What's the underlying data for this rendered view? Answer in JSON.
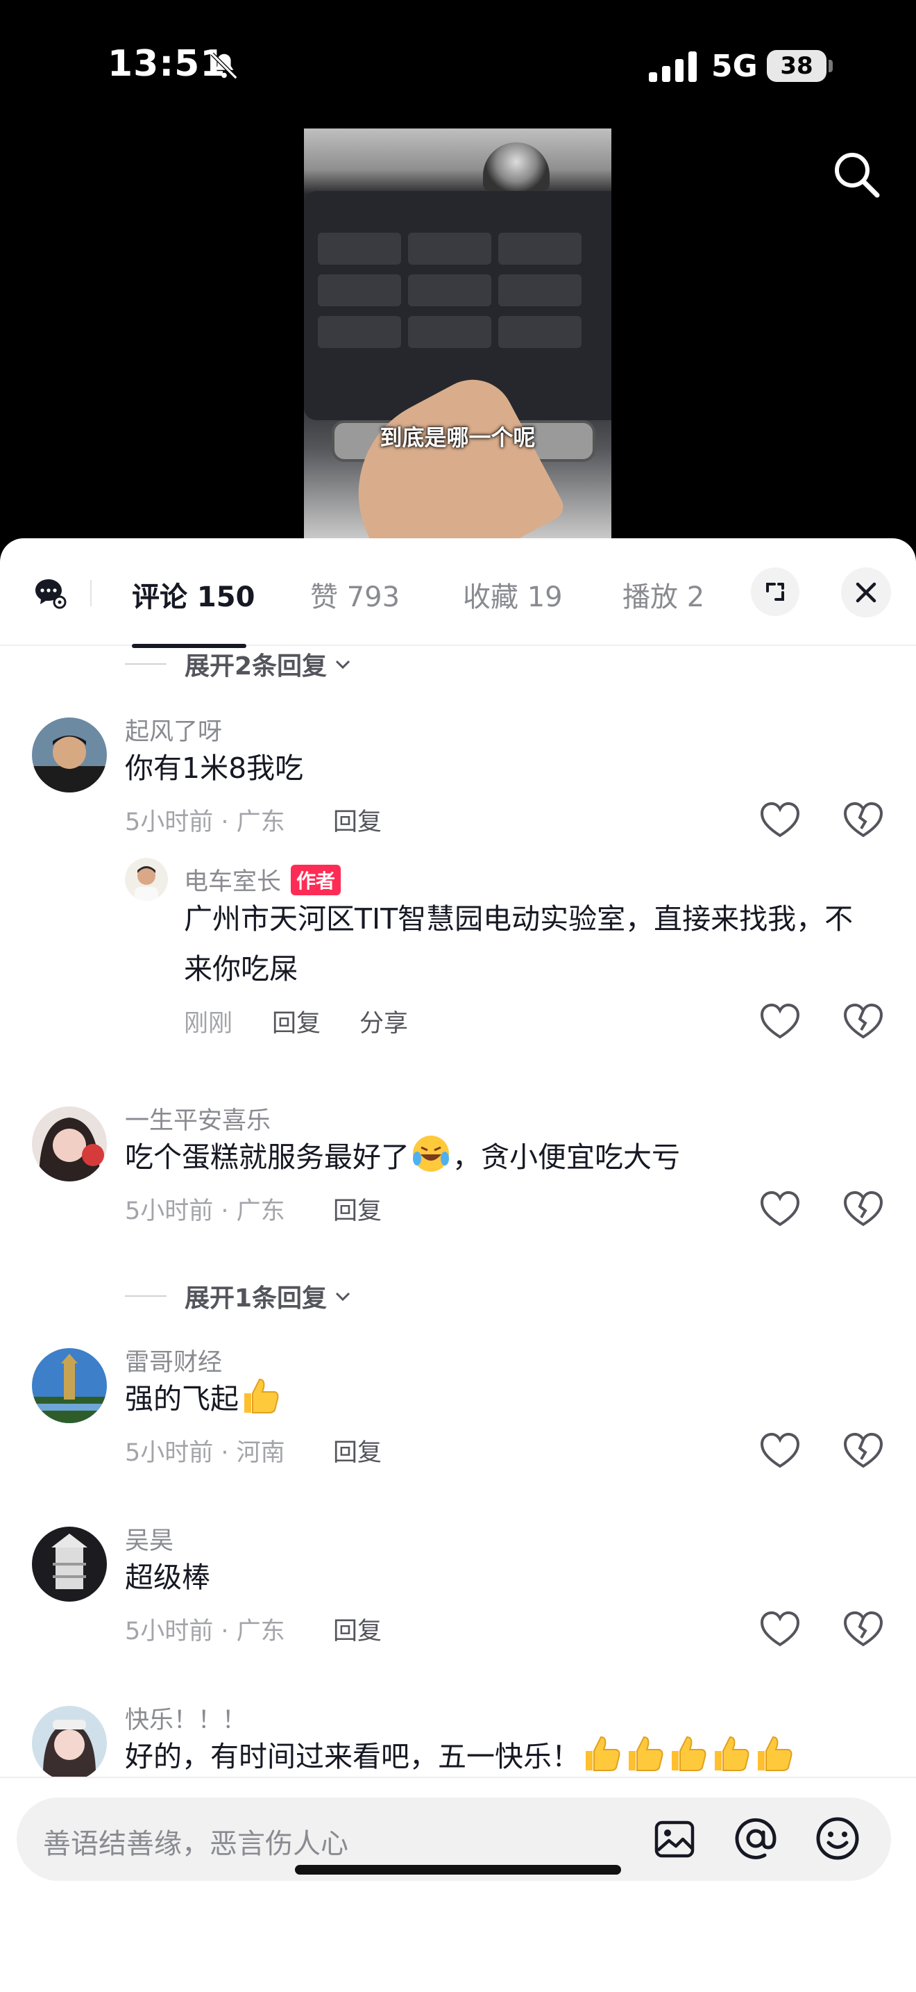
{
  "status_bar": {
    "time": "13:51",
    "network": "5G",
    "battery": "38"
  },
  "video": {
    "caption": "到底是哪一个呢"
  },
  "tabs": [
    {
      "label": "评论 150"
    },
    {
      "label": "赞 793"
    },
    {
      "label": "收藏 19"
    },
    {
      "label": "播放 2"
    }
  ],
  "expand_replies": [
    {
      "label": "展开2条回复"
    },
    {
      "label": "展开1条回复"
    }
  ],
  "comments": [
    {
      "user": "起风了呀",
      "text": "你有1米8我吃",
      "time": "5小时前 · 广东",
      "reply": "回复"
    },
    {
      "user": "电车室长",
      "tag": "作者",
      "text": "广州市天河区TIT智慧园电动实验室，直接来找我，不来你吃屎",
      "time": "刚刚",
      "reply": "回复",
      "share": "分享"
    },
    {
      "user": "一生平安喜乐",
      "text_before": "吃个蛋糕就服务最好了",
      "text_after": "，贪小便宜吃大亏",
      "time": "5小时前 · 广东",
      "reply": "回复"
    },
    {
      "user": "雷哥财经",
      "text": "强的飞起",
      "time": "5小时前 · 河南",
      "reply": "回复"
    },
    {
      "user": "吴昊",
      "text": "超级棒",
      "time": "5小时前 · 广东",
      "reply": "回复"
    },
    {
      "user": "快乐！！！",
      "text": "好的，有时间过来看吧，五一快乐！"
    }
  ],
  "input": {
    "placeholder": "善语结善缘，恶言伤人心"
  },
  "icons": {
    "bell": "bell-off-icon",
    "search": "search-icon",
    "expand": "expand-icon",
    "close": "close-icon",
    "like": "heart-icon",
    "dislike": "broken-heart-icon",
    "image": "image-icon",
    "at": "at-icon",
    "emoji": "smiley-icon"
  },
  "colors": {
    "accent": "#fe2c55",
    "text": "#161823",
    "muted": "#8a8b91"
  }
}
